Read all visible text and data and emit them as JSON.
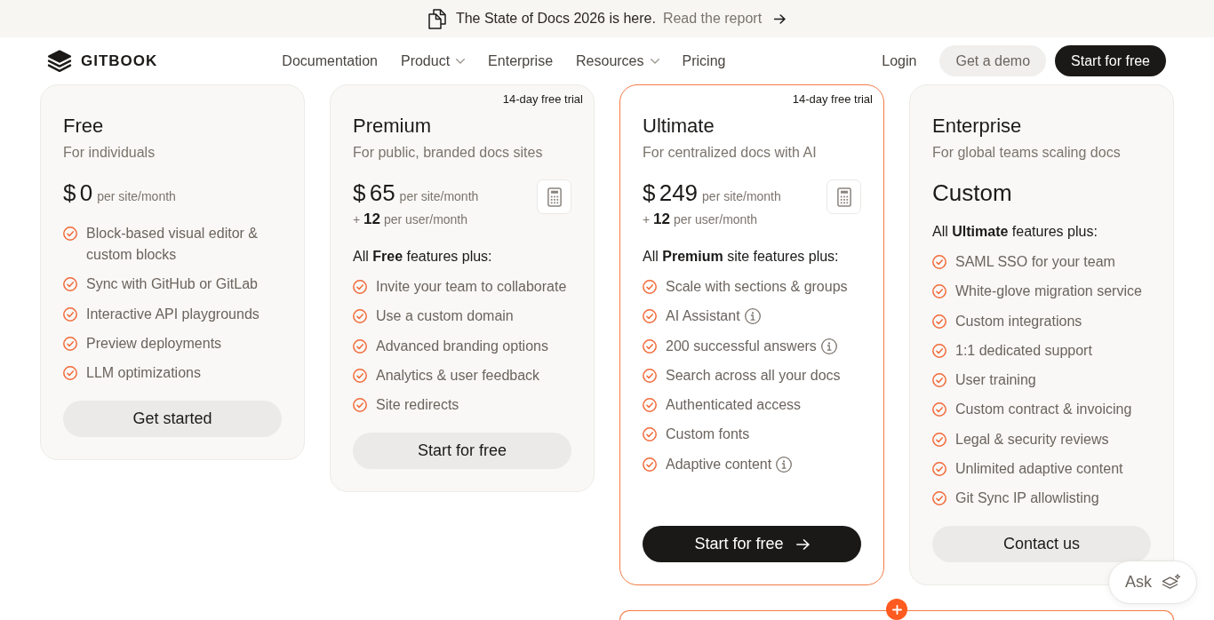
{
  "announcement": {
    "text": "The State of Docs 2026 is here.",
    "link": "Read the report"
  },
  "nav": {
    "logo": "GITBOOK",
    "links": [
      {
        "label": "Documentation",
        "dropdown": false
      },
      {
        "label": "Product",
        "dropdown": true
      },
      {
        "label": "Enterprise",
        "dropdown": false
      },
      {
        "label": "Resources",
        "dropdown": true
      },
      {
        "label": "Pricing",
        "dropdown": false
      }
    ],
    "login": "Login",
    "buttons": [
      {
        "label": "Get a demo",
        "kind": "light"
      },
      {
        "label": "Start for free",
        "kind": "dark"
      }
    ]
  },
  "plans": [
    {
      "name": "Free",
      "tagline": "For individuals",
      "featured": false,
      "price": "$ 0",
      "unit": "per site/month",
      "calculator": false,
      "features": [
        {
          "text": "Block-based visual editor & custom blocks",
          "info": false
        },
        {
          "text": "Sync with GitHub or GitLab",
          "info": false
        },
        {
          "text": "Interactive API playgrounds",
          "info": false
        },
        {
          "text": "Preview deployments",
          "info": false
        },
        {
          "text": "LLM optimizations",
          "info": false
        }
      ],
      "button": {
        "label": "Get started",
        "kind": "light",
        "arrow": false
      }
    },
    {
      "name": "Premium",
      "badge": "14-day free trial",
      "tagline": "For public, branded docs sites",
      "featured": false,
      "price": "$ 65",
      "unit": "per site/month",
      "user_price": "+ **12** per user/month",
      "calculator": true,
      "includes": "All **Free** features plus:",
      "features": [
        {
          "text": "Invite your team to collaborate",
          "info": false
        },
        {
          "text": "Use a custom domain",
          "info": false
        },
        {
          "text": "Advanced branding options",
          "info": false
        },
        {
          "text": "Analytics & user feedback",
          "info": false
        },
        {
          "text": "Site redirects",
          "info": false
        }
      ],
      "button": {
        "label": "Start for free",
        "kind": "light",
        "arrow": false
      }
    },
    {
      "name": "Ultimate",
      "badge": "14-day free trial",
      "tagline": "For centralized docs with AI",
      "featured": true,
      "price": "$ 249",
      "unit": "per site/month",
      "user_price": "+ **12** per user/month",
      "calculator": true,
      "includes": "All **Premium** site features plus:",
      "features": [
        {
          "text": "Scale with sections & groups",
          "info": false
        },
        {
          "text": "AI Assistant",
          "info": true
        },
        {
          "text": "200 successful answers",
          "info": true
        },
        {
          "text": "Search across all your docs",
          "info": false
        },
        {
          "text": "Authenticated access",
          "info": false
        },
        {
          "text": "Custom fonts",
          "info": false
        },
        {
          "text": "Adaptive content",
          "info": true
        }
      ],
      "button": {
        "label": "Start for free",
        "kind": "dark",
        "arrow": true
      }
    },
    {
      "name": "Enterprise",
      "tagline": "For global teams scaling docs",
      "featured": false,
      "price": "Custom",
      "calculator": false,
      "includes": "All **Ultimate** features plus:",
      "features": [
        {
          "text": "SAML SSO for your team",
          "info": false
        },
        {
          "text": "White-glove migration service",
          "info": false
        },
        {
          "text": "Custom integrations",
          "info": false
        },
        {
          "text": "1:1 dedicated support",
          "info": false
        },
        {
          "text": "User training",
          "info": false
        },
        {
          "text": "Custom contract & invoicing",
          "info": false
        },
        {
          "text": "Legal & security reviews",
          "info": false
        },
        {
          "text": "Unlimited adaptive content",
          "info": false
        },
        {
          "text": "Git Sync IP allowlisting",
          "info": false
        }
      ],
      "button": {
        "label": "Contact us",
        "kind": "light",
        "arrow": false
      }
    }
  ],
  "ask_button": "Ask"
}
